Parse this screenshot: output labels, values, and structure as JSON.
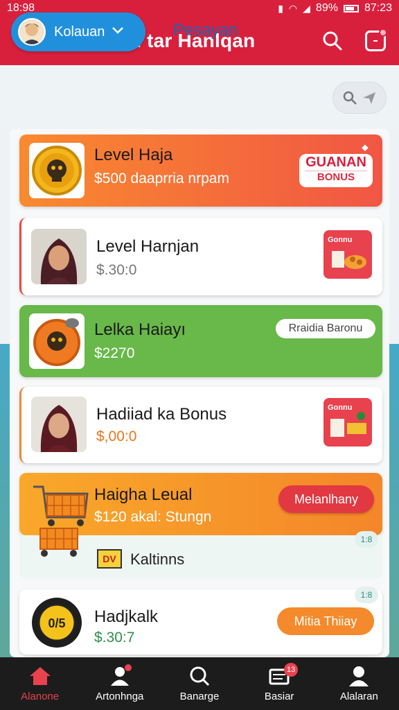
{
  "status_bar": {
    "time": "18:98",
    "battery": "89%",
    "clock": "87:23"
  },
  "app_bar": {
    "title": "Caualam tar Hanlqan"
  },
  "filter": {
    "user_label": "Kolauan",
    "tab_label": "Pesayan"
  },
  "cards": [
    {
      "title": "Level Haja",
      "subtitle": "$500 daaprria nrpam",
      "badge_line1": "GUANAN",
      "badge_line2": "BONUS"
    },
    {
      "title": "Level Harnjan",
      "subtitle": "$.30:0",
      "tile_label": "Gonnu"
    },
    {
      "title": "Lelka Haiayı",
      "subtitle": "$2270",
      "badge": "Rraidia Baronu"
    },
    {
      "title": "Hadiiad ka Bonus",
      "subtitle": "$,00:0",
      "tile_label": "Gonnu"
    },
    {
      "title": "Haigha Leual",
      "subtitle": "$120 akal: Stungn",
      "button": "Melanlhany"
    },
    {
      "label": "Kaltinns",
      "tag": "DV",
      "mini_tag": "1:8"
    },
    {
      "title": "Hadjkalk",
      "subtitle": "$.30:7",
      "button": "Mitia Thiiay",
      "mini_tag": "1:8"
    }
  ],
  "bottom_nav": [
    {
      "label": "Alanone",
      "active": true
    },
    {
      "label": "Artonhnga",
      "dot": true
    },
    {
      "label": "Banarge"
    },
    {
      "label": "Basiar",
      "badge": "13"
    },
    {
      "label": "Alalaran"
    }
  ],
  "colors": {
    "primary": "#d8203d",
    "green": "#69b84a",
    "orange": "#f48a2c",
    "blue": "#2190dc"
  }
}
